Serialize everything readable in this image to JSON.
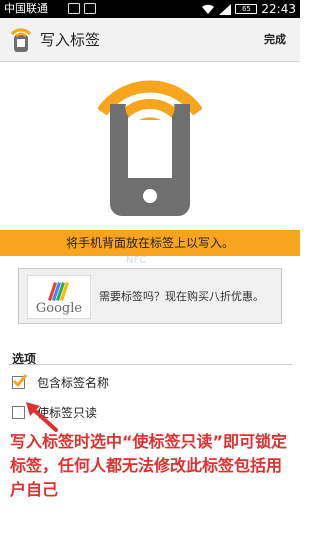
{
  "status_bar": {
    "carrier": "中国联通",
    "battery": "65",
    "time": "22:43"
  },
  "action_bar": {
    "title": "写入标签",
    "done": "完成"
  },
  "colors": {
    "accent": "#f6a51c",
    "phone_gray": "#6f6f6f",
    "annotation_red": "#e03030"
  },
  "banner": {
    "text": "将手机背面放在标签上以写入。"
  },
  "ad": {
    "logo_text": "Google",
    "text": "需要标签吗？现在购买八折优惠。"
  },
  "options": {
    "header": "选项",
    "items": [
      {
        "label": "包含标签名称",
        "checked": true
      },
      {
        "label": "使标签只读",
        "checked": false
      }
    ]
  },
  "annotation": {
    "text": "写入标签时选中“使标签只读”即可锁定标签，任何人都无法修改此标签包括用户自己"
  }
}
